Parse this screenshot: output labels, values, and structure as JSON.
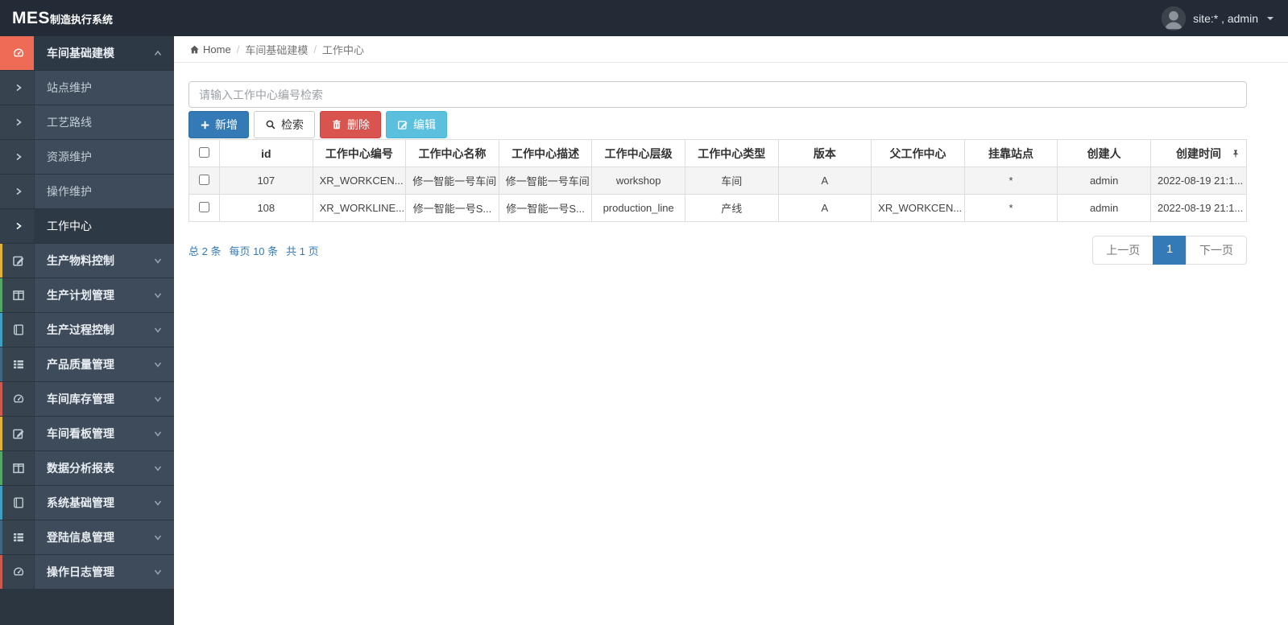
{
  "theme": {
    "navbar_bg": "#232c36",
    "sidebar_bg": "#2b3641",
    "sidebar_row_bg": "#3e4b5a",
    "sidebar_active_bg": "#2d3945",
    "active_group_accent": "#ee6c55",
    "primary": "#337ab7",
    "danger": "#d9534f",
    "info": "#5bc0de",
    "link_blue": "#337ab7"
  },
  "navbar": {
    "logo_primary": "MES",
    "logo_secondary": "制造执行系统",
    "user_label": "site:* , admin"
  },
  "breadcrumb": {
    "home": "Home",
    "section": "车间基础建模",
    "current": "工作中心"
  },
  "sidebar": {
    "sections": [
      {
        "kind": "group",
        "label": "车间基础建模",
        "icon": "gauge-icon",
        "state": "open",
        "accent": "#ee6c55"
      },
      {
        "kind": "sub",
        "label": "站点维护"
      },
      {
        "kind": "sub",
        "label": "工艺路线"
      },
      {
        "kind": "sub",
        "label": "资源维护"
      },
      {
        "kind": "sub",
        "label": "操作维护"
      },
      {
        "kind": "sub",
        "label": "工作中心",
        "active": true
      },
      {
        "kind": "group",
        "label": "生产物料控制",
        "icon": "edit-icon",
        "accent": "#e0b23c"
      },
      {
        "kind": "group",
        "label": "生产计划管理",
        "icon": "columns-icon",
        "accent": "#53a766"
      },
      {
        "kind": "group",
        "label": "生产过程控制",
        "icon": "book-icon",
        "accent": "#3f9fc0"
      },
      {
        "kind": "group",
        "label": "产品质量管理",
        "icon": "th-list-icon",
        "accent": "#3d6884"
      },
      {
        "kind": "group",
        "label": "车间库存管理",
        "icon": "gauge-icon",
        "accent": "#cd5a4e"
      },
      {
        "kind": "group",
        "label": "车间看板管理",
        "icon": "edit-icon",
        "accent": "#e0b23c"
      },
      {
        "kind": "group",
        "label": "数据分析报表",
        "icon": "columns-icon",
        "accent": "#53a766"
      },
      {
        "kind": "group",
        "label": "系统基础管理",
        "icon": "book-icon",
        "accent": "#3f9fc0"
      },
      {
        "kind": "group",
        "label": "登陆信息管理",
        "icon": "th-list-icon",
        "accent": "#3d6884"
      },
      {
        "kind": "group",
        "label": "操作日志管理",
        "icon": "gauge-icon",
        "accent": "#cd5a4e"
      }
    ]
  },
  "search": {
    "placeholder": "请输入工作中心编号检索",
    "value": ""
  },
  "toolbar": {
    "add_label": "新增",
    "search_label": "检索",
    "delete_label": "删除",
    "edit_label": "编辑"
  },
  "table": {
    "columns": [
      "id",
      "工作中心编号",
      "工作中心名称",
      "工作中心描述",
      "工作中心层级",
      "工作中心类型",
      "版本",
      "父工作中心",
      "挂靠站点",
      "创建人",
      "创建时间"
    ],
    "rows": [
      [
        "107",
        "XR_WORKCEN...",
        "修一智能一号车间",
        "修一智能一号车间",
        "workshop",
        "车间",
        "A",
        "",
        "*",
        "admin",
        "2022-08-19 21:1..."
      ],
      [
        "108",
        "XR_WORKLINE...",
        "修一智能一号S...",
        "修一智能一号S...",
        "production_line",
        "产线",
        "A",
        "XR_WORKCEN...",
        "*",
        "admin",
        "2022-08-19 21:1..."
      ]
    ]
  },
  "pagination": {
    "summary_total": "总 2 条",
    "summary_per_page": "每页 10 条",
    "summary_pages": "共 1 页",
    "prev_label": "上一页",
    "current_page": "1",
    "next_label": "下一页"
  }
}
